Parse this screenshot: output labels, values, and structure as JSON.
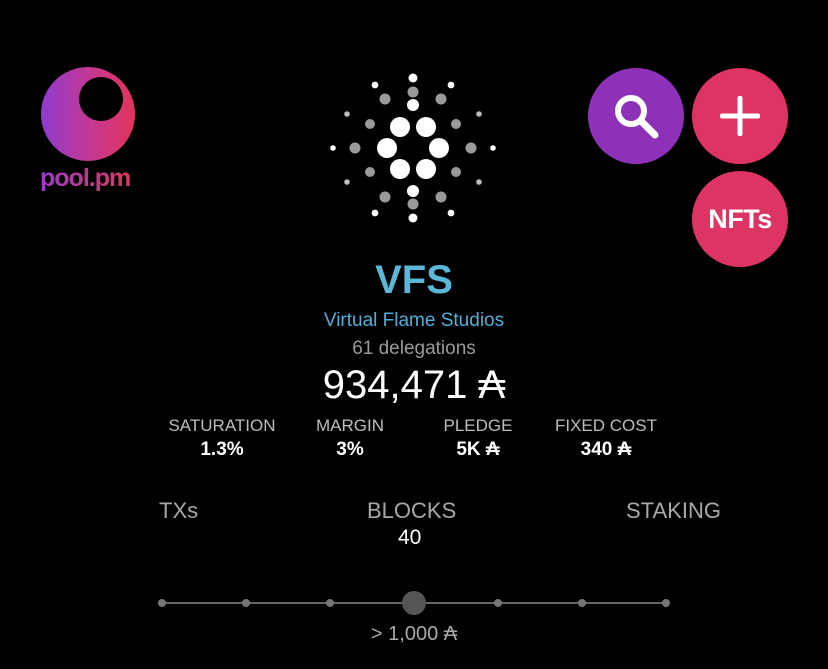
{
  "brand": {
    "name": "pool.pm"
  },
  "buttons": {
    "search": "search-icon",
    "add": "plus-icon",
    "nfts_label": "NFTs"
  },
  "pool": {
    "ticker": "VFS",
    "name": "Virtual Flame Studios",
    "delegations": "61 delegations",
    "live_stake": "934,471 ₳"
  },
  "stats": [
    {
      "label": "SATURATION",
      "value": "1.3%"
    },
    {
      "label": "MARGIN",
      "value": "3%"
    },
    {
      "label": "PLEDGE",
      "value": "5K ₳"
    },
    {
      "label": "FIXED COST",
      "value": "340 ₳"
    }
  ],
  "tabs": [
    {
      "label": "TXs"
    },
    {
      "label": "BLOCKS",
      "count": "40"
    },
    {
      "label": "STAKING"
    }
  ],
  "filter": {
    "caption": "> 1,000 ₳",
    "steps": 7,
    "selected_index": 3
  },
  "colors": {
    "accent_blue": "#5bb6d8",
    "search_purple": "#8e30b8",
    "action_pink": "#de3463"
  }
}
